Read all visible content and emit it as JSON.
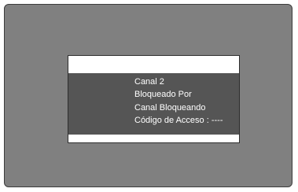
{
  "dialog": {
    "lines": [
      "Canal 2",
      "Bloqueado Por",
      "Canal Bloqueando",
      "Código de Acceso : ----"
    ]
  }
}
